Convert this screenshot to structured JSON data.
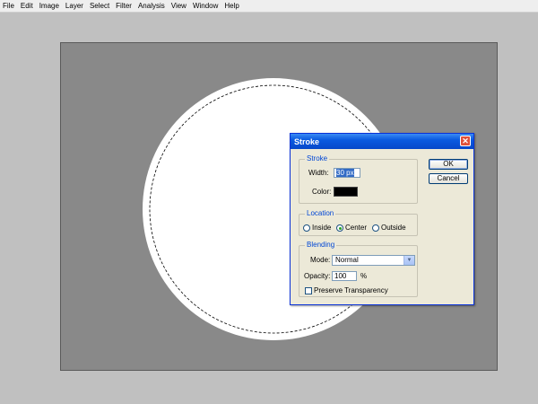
{
  "menubar": {
    "items": [
      "File",
      "Edit",
      "Image",
      "Layer",
      "Select",
      "Filter",
      "Analysis",
      "View",
      "Window",
      "Help"
    ]
  },
  "dialog": {
    "title": "Stroke",
    "close_icon": "close-icon",
    "stroke_group": {
      "legend": "Stroke",
      "width_label": "Width:",
      "width_value": "30 px",
      "color_label": "Color:",
      "color": "#000000"
    },
    "location_group": {
      "legend": "Location",
      "options": [
        "Inside",
        "Center",
        "Outside"
      ],
      "selected": "Center"
    },
    "blending_group": {
      "legend": "Blending",
      "mode_label": "Mode:",
      "mode_value": "Normal",
      "opacity_label": "Opacity:",
      "opacity_value": "100",
      "opacity_unit": "%",
      "preserve_label": "Preserve Transparency",
      "preserve_checked": false
    },
    "ok_label": "OK",
    "cancel_label": "Cancel"
  },
  "colors": {
    "workspace": "#c0c0c0",
    "canvas": "#898989",
    "shape": "#ffffff",
    "title_bar": "#0a5ae0"
  }
}
